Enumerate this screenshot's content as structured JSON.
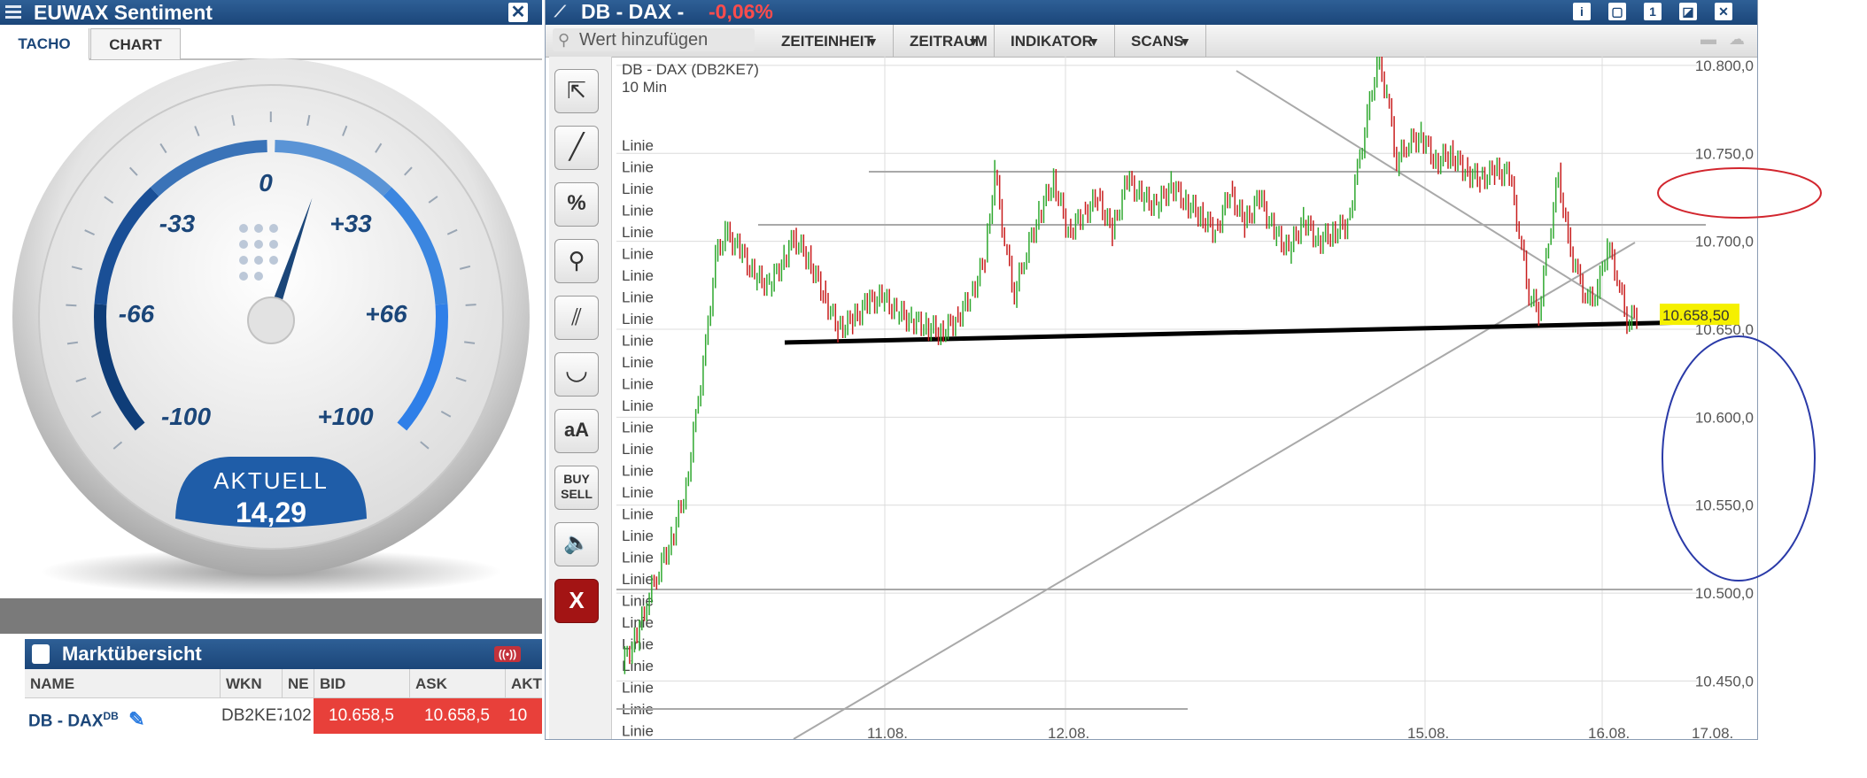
{
  "sentiment": {
    "title": "EUWAX Sentiment",
    "tabs": [
      "TACHO",
      "CHART"
    ],
    "gauge": {
      "labels": [
        "0",
        "-33",
        "+33",
        "-66",
        "+66",
        "-100",
        "+100"
      ],
      "aktuell_label": "AKTUELL",
      "aktuell_value": "14,29",
      "needle_value": 14.29
    }
  },
  "market": {
    "title": "Marktübersicht",
    "columns": [
      "NAME",
      "WKN",
      "NE",
      "BID",
      "ASK",
      "AKT"
    ],
    "row": {
      "name": "DB - DAX",
      "name_sup": "DB",
      "wkn": "DB2KE7",
      "ne": "102",
      "bid": "10.658,5",
      "ask": "10.658,5",
      "akt": "10"
    }
  },
  "chart_window": {
    "title": "DB - DAX -",
    "change": "-0,06%",
    "search_placeholder": "Wert hinzufügen",
    "toolbar": [
      "ZEITEINHEIT",
      "ZEITRAUM",
      "INDIKATOR",
      "SCANS"
    ],
    "tools": [
      "cursor-icon",
      "line-icon",
      "percent-icon",
      "zoom-icon",
      "parallel-icon",
      "curve-icon",
      "text-icon",
      "buy-sell-icon",
      "sound-icon",
      "delete-icon"
    ],
    "tool_texts": {
      "aA": "aA",
      "buy": "BUY",
      "sell": "SELL",
      "x": "X",
      "pct": "%"
    }
  },
  "chart_data": {
    "type": "line",
    "title": "DB - DAX (DB2KE7)",
    "subtitle": "10 Min",
    "y_ticks": [
      "10.800,0",
      "10.750,0",
      "10.700,0",
      "10.650,0",
      "10.600,0",
      "10.550,0",
      "10.500,0",
      "10.450,0"
    ],
    "ylim": [
      10417,
      10805
    ],
    "x_labels": [
      "11.08.",
      "12.08.",
      "15.08.",
      "16.08.",
      "17.08."
    ],
    "last_price_label": "10.658,50",
    "drawing_label": "Linie",
    "drawing_label_count": 28,
    "series": [
      {
        "points": [
          [
            0,
            10460
          ],
          [
            6,
            10475
          ],
          [
            10,
            10495
          ],
          [
            14,
            10510
          ],
          [
            20,
            10530
          ],
          [
            26,
            10560
          ],
          [
            30,
            10600
          ],
          [
            34,
            10640
          ],
          [
            38,
            10690
          ],
          [
            42,
            10705
          ],
          [
            48,
            10695
          ],
          [
            54,
            10680
          ],
          [
            60,
            10675
          ],
          [
            66,
            10690
          ],
          [
            70,
            10702
          ],
          [
            76,
            10690
          ],
          [
            82,
            10670
          ],
          [
            88,
            10650
          ],
          [
            94,
            10655
          ],
          [
            100,
            10665
          ],
          [
            106,
            10668
          ],
          [
            112,
            10660
          ],
          [
            118,
            10655
          ],
          [
            124,
            10652
          ],
          [
            130,
            10648
          ],
          [
            136,
            10655
          ],
          [
            142,
            10668
          ],
          [
            148,
            10690
          ],
          [
            152,
            10740
          ],
          [
            156,
            10700
          ],
          [
            160,
            10670
          ],
          [
            164,
            10690
          ],
          [
            170,
            10715
          ],
          [
            176,
            10735
          ],
          [
            182,
            10705
          ],
          [
            188,
            10715
          ],
          [
            194,
            10725
          ],
          [
            200,
            10705
          ],
          [
            206,
            10735
          ],
          [
            212,
            10725
          ],
          [
            218,
            10720
          ],
          [
            224,
            10732
          ],
          [
            230,
            10722
          ],
          [
            236,
            10715
          ],
          [
            242,
            10705
          ],
          [
            248,
            10728
          ],
          [
            254,
            10710
          ],
          [
            260,
            10725
          ],
          [
            266,
            10705
          ],
          [
            272,
            10695
          ],
          [
            278,
            10712
          ],
          [
            284,
            10700
          ],
          [
            290,
            10705
          ],
          [
            296,
            10710
          ],
          [
            300,
            10740
          ],
          [
            304,
            10770
          ],
          [
            308,
            10802
          ],
          [
            312,
            10785
          ],
          [
            316,
            10745
          ],
          [
            320,
            10755
          ],
          [
            326,
            10760
          ],
          [
            332,
            10745
          ],
          [
            338,
            10750
          ],
          [
            344,
            10740
          ],
          [
            350,
            10735
          ],
          [
            356,
            10740
          ],
          [
            362,
            10738
          ],
          [
            366,
            10705
          ],
          [
            370,
            10670
          ],
          [
            374,
            10660
          ],
          [
            378,
            10700
          ],
          [
            382,
            10738
          ],
          [
            386,
            10700
          ],
          [
            390,
            10680
          ],
          [
            394,
            10665
          ],
          [
            398,
            10672
          ],
          [
            402,
            10698
          ],
          [
            406,
            10680
          ],
          [
            410,
            10655
          ],
          [
            414,
            10658
          ]
        ]
      }
    ],
    "x_max": 420,
    "grid": true
  }
}
